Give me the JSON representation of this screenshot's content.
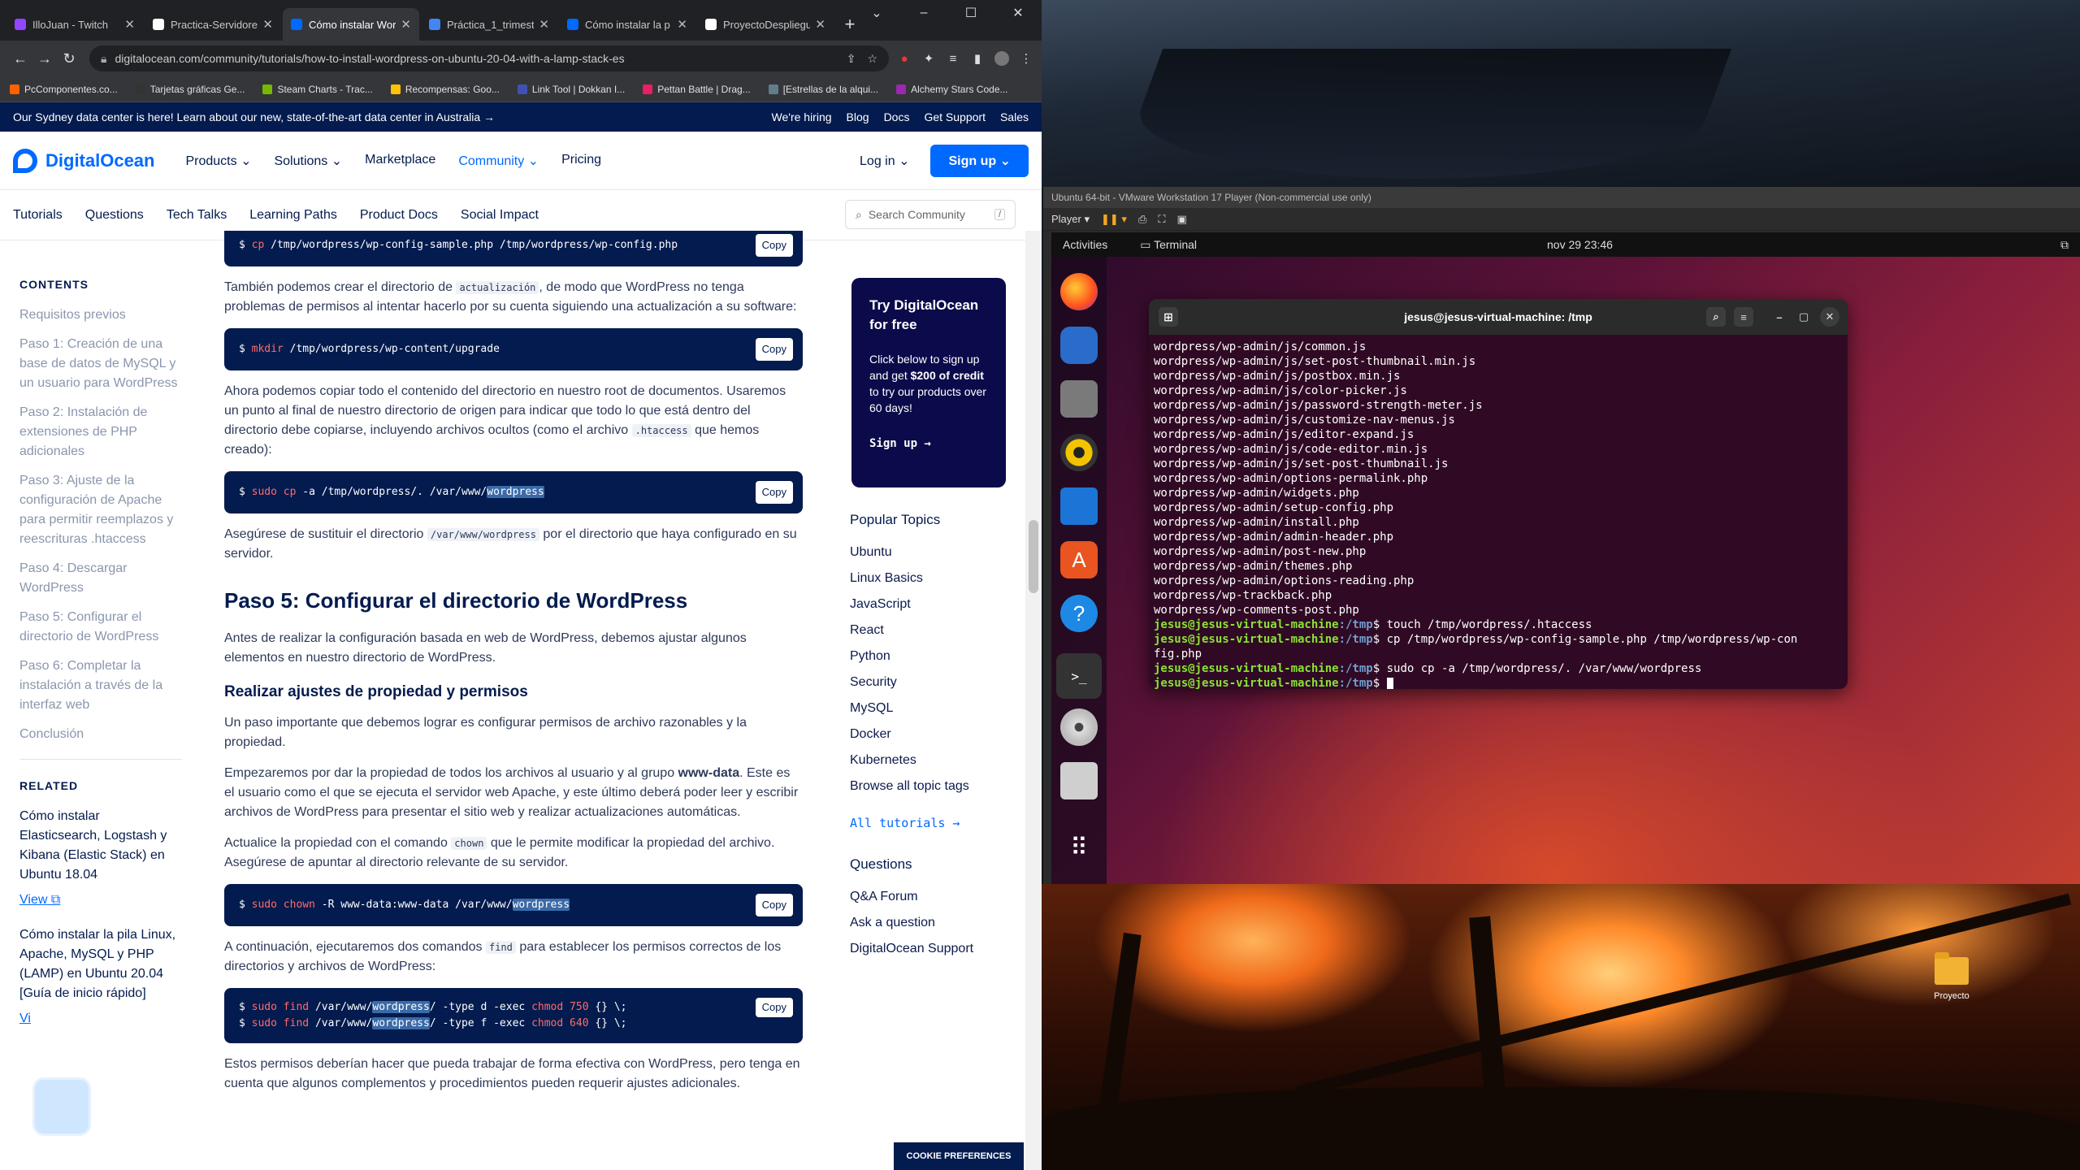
{
  "browser": {
    "tabs": [
      {
        "label": "IlloJuan - Twitch",
        "color": "#9146ff",
        "active": false
      },
      {
        "label": "Practica-Servidores",
        "color": "#ffffff",
        "active": false
      },
      {
        "label": "Cómo instalar Wor",
        "color": "#0069ff",
        "active": true
      },
      {
        "label": "Práctica_1_trimestr",
        "color": "#4285f4",
        "active": false
      },
      {
        "label": "Cómo instalar la p",
        "color": "#0069ff",
        "active": false
      },
      {
        "label": "ProyectoDespliegu",
        "color": "#ffffff",
        "active": false
      }
    ],
    "new_tab": "+",
    "url": "digitalocean.com/community/tutorials/how-to-install-wordpress-on-ubuntu-20-04-with-a-lamp-stack-es",
    "bookmarks": [
      {
        "label": "PcComponentes.co...",
        "color": "#ff6000"
      },
      {
        "label": "Tarjetas gráficas Ge...",
        "color": "#333333"
      },
      {
        "label": "Steam Charts - Trac...",
        "color": "#76b900"
      },
      {
        "label": "Recompensas: Goo...",
        "color": "#ffc107"
      },
      {
        "label": "Link Tool | Dokkan I...",
        "color": "#3f51b5"
      },
      {
        "label": "Pettan Battle | Drag...",
        "color": "#e91e63"
      },
      {
        "label": "[Estrellas de la alqui...",
        "color": "#607d8b"
      },
      {
        "label": "Alchemy Stars Code...",
        "color": "#9c27b0"
      }
    ]
  },
  "announce": {
    "text": "Our Sydney data center is here! Learn about our new, state-of-the-art data center in Australia →",
    "links": [
      "We're hiring",
      "Blog",
      "Docs",
      "Get Support",
      "Sales"
    ]
  },
  "nav": {
    "brand": "DigitalOcean",
    "items": [
      "Products",
      "Solutions",
      "Marketplace",
      "Community",
      "Pricing"
    ],
    "login": "Log in",
    "signup": "Sign up"
  },
  "subnav": {
    "items": [
      "Tutorials",
      "Questions",
      "Tech Talks",
      "Learning Paths",
      "Product Docs",
      "Social Impact"
    ],
    "search_placeholder": "Search Community",
    "kbd": "/"
  },
  "contents": {
    "heading": "CONTENTS",
    "items": [
      "Requisitos previos",
      "Paso 1: Creación de una base de datos de MySQL y un usuario para WordPress",
      "Paso 2: Instalación de extensiones de PHP adicionales",
      "Paso 3: Ajuste de la configuración de Apache para permitir reemplazos y reescrituras .htaccess",
      "Paso 4: Descargar WordPress",
      "Paso 5: Configurar el directorio de WordPress",
      "Paso 6: Completar la instalación a través de la interfaz web",
      "Conclusión"
    ]
  },
  "related": {
    "heading": "RELATED",
    "items": [
      {
        "title": "Cómo instalar Elasticsearch, Logstash y Kibana (Elastic Stack) en Ubuntu 18.04",
        "link": "View"
      },
      {
        "title": "Cómo instalar la pila Linux, Apache, MySQL y PHP (LAMP) en Ubuntu 20.04 [Guía de inicio rápido]",
        "link": "Vi"
      }
    ]
  },
  "article": {
    "code1": "/tmp/wordpress/wp-config-sample.php /tmp/wordpress/wp-config.php",
    "code1_cmd": "cp",
    "p1_a": "También podemos crear el directorio de ",
    "p1_code": "actualización",
    "p1_b": ", de modo que WordPress no tenga problemas de permisos al intentar hacerlo por su cuenta siguiendo una actualización a su software:",
    "code2_cmd": "mkdir",
    "code2": "/tmp/wordpress/wp-content/upgrade",
    "p2_a": "Ahora podemos copiar todo el contenido del directorio en nuestro root de documentos. Usaremos un punto al final de nuestro directorio de origen para indicar que todo lo que está dentro del directorio debe copiarse, incluyendo archivos ocultos (como el archivo ",
    "p2_code": ".htaccess",
    "p2_b": " que hemos creado):",
    "code3_cmd": "sudo cp",
    "code3": "-a /tmp/wordpress/. /var/www/",
    "code3_hl": "wordpress",
    "p3_a": "Asegúrese de sustituir el directorio ",
    "p3_code": "/var/www/wordpress",
    "p3_b": " por el directorio que haya configurado en su servidor.",
    "h2": "Paso 5: Configurar el directorio de WordPress",
    "p4": "Antes de realizar la configuración basada en web de WordPress, debemos ajustar algunos elementos en nuestro directorio de WordPress.",
    "h3": "Realizar ajustes de propiedad y permisos",
    "p5": "Un paso importante que debemos lograr es configurar permisos de archivo razonables y la propiedad.",
    "p6_a": "Empezaremos por dar la propiedad de todos los archivos al usuario y al grupo ",
    "p6_bold": "www-data",
    "p6_b": ". Este es el usuario como el que se ejecuta el servidor web Apache, y este último deberá poder leer y escribir archivos de WordPress para presentar el sitio web y realizar actualizaciones automáticas.",
    "p7_a": "Actualice la propiedad con el comando ",
    "p7_code": "chown",
    "p7_b": " que le permite modificar la propiedad del archivo. Asegúrese de apuntar al directorio relevante de su servidor.",
    "code4_cmd": "sudo chown",
    "code4": "-R www-data:www-data /var/www/",
    "code4_hl": "wordpress",
    "p8_a": "A continuación, ejecutaremos dos comandos ",
    "p8_code": "find",
    "p8_b": " para establecer los permisos correctos de los directorios y archivos de WordPress:",
    "code5_l1_cmd": "sudo find",
    "code5_l1_a": "/var/www/",
    "code5_l1_hl": "wordpress",
    "code5_l1_b": "/ -type d -exec",
    "code5_l1_c": "chmod",
    "code5_l1_n": "750",
    "code5_l1_d": "{} \\;",
    "code5_l2_cmd": "sudo find",
    "code5_l2_a": "/var/www/",
    "code5_l2_hl": "wordpress",
    "code5_l2_b": "/ -type f -exec",
    "code5_l2_c": "chmod",
    "code5_l2_n": "640",
    "code5_l2_d": "{} \\;",
    "p9": "Estos permisos deberían hacer que pueda trabajar de forma efectiva con WordPress, pero tenga en cuenta que algunos complementos y procedimientos pueden requerir ajustes adicionales.",
    "copy": "Copy",
    "prompt": "$"
  },
  "promo": {
    "title": "Try DigitalOcean for free",
    "text_a": "Click below to sign up and get ",
    "text_bold": "$200 of credit",
    "text_b": " to try our products over 60 days!",
    "cta": "Sign up →"
  },
  "topics": {
    "heading": "Popular Topics",
    "items": [
      "Ubuntu",
      "Linux Basics",
      "JavaScript",
      "React",
      "Python",
      "Security",
      "MySQL",
      "Docker",
      "Kubernetes",
      "Browse all topic tags"
    ],
    "all": "All tutorials →"
  },
  "questions": {
    "heading": "Questions",
    "items": [
      "Q&A Forum",
      "Ask a question",
      "DigitalOcean Support"
    ]
  },
  "cookie": "COOKIE PREFERENCES",
  "vmware": {
    "title": "Ubuntu 64-bit - VMware Workstation 17 Player (Non-commercial use only)",
    "player": "Player ▾"
  },
  "ubuntu": {
    "activities": "Activities",
    "app": "Terminal",
    "clock": "nov 29  23:46"
  },
  "terminal": {
    "title": "jesus@jesus-virtual-machine: /tmp",
    "lines": [
      "wordpress/wp-admin/js/common.js",
      "wordpress/wp-admin/js/set-post-thumbnail.min.js",
      "wordpress/wp-admin/js/postbox.min.js",
      "wordpress/wp-admin/js/color-picker.js",
      "wordpress/wp-admin/js/password-strength-meter.js",
      "wordpress/wp-admin/js/customize-nav-menus.js",
      "wordpress/wp-admin/js/editor-expand.js",
      "wordpress/wp-admin/js/code-editor.min.js",
      "wordpress/wp-admin/js/set-post-thumbnail.js",
      "wordpress/wp-admin/options-permalink.php",
      "wordpress/wp-admin/widgets.php",
      "wordpress/wp-admin/setup-config.php",
      "wordpress/wp-admin/install.php",
      "wordpress/wp-admin/admin-header.php",
      "wordpress/wp-admin/post-new.php",
      "wordpress/wp-admin/themes.php",
      "wordpress/wp-admin/options-reading.php",
      "wordpress/wp-trackback.php",
      "wordpress/wp-comments-post.php"
    ],
    "user": "jesus@jesus-virtual-machine",
    "path": ":/tmp",
    "cmds": [
      "$ touch /tmp/wordpress/.htaccess",
      "$ cp /tmp/wordpress/wp-config-sample.php /tmp/wordpress/wp-con",
      "fig.php",
      "$ sudo cp -a /tmp/wordpress/. /var/www/wordpress",
      "$ "
    ]
  },
  "desktop_icon": "Proyecto"
}
